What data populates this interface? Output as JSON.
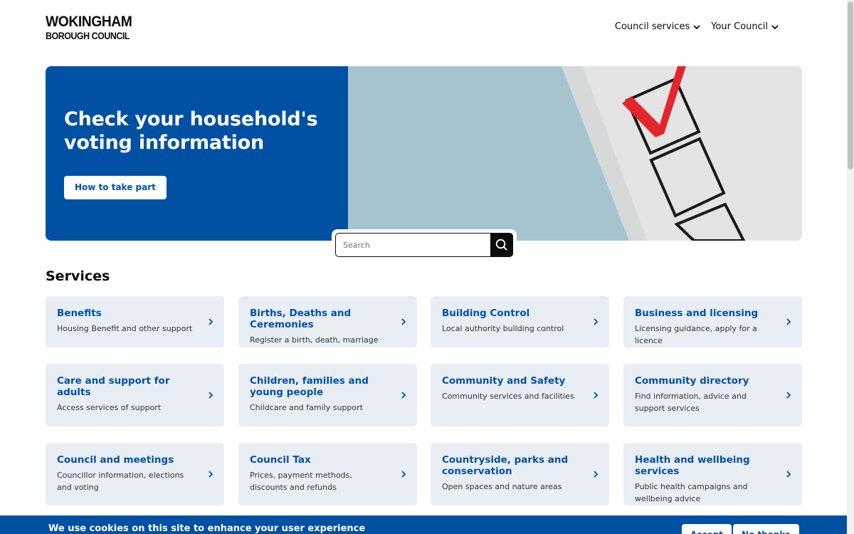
{
  "header": {
    "logo_line1": "WOKINGHAM",
    "logo_line2": "BOROUGH COUNCIL",
    "nav": [
      {
        "label": "Council services"
      },
      {
        "label": "Your Council"
      }
    ]
  },
  "hero": {
    "title": "Check your household's voting information",
    "button_label": "How to take part",
    "image_icon": "ballot-checkbox-icon"
  },
  "search": {
    "placeholder": "Search",
    "icon": "search-icon"
  },
  "services": {
    "heading": "Services",
    "cards": [
      {
        "title": "Benefits",
        "desc": "Housing Benefit and other support"
      },
      {
        "title": "Births, Deaths and Ceremonies",
        "desc": "Register a birth, death, marriage"
      },
      {
        "title": "Building Control",
        "desc": "Local authority building control"
      },
      {
        "title": "Business and licensing",
        "desc": "Licensing guidance, apply for a licence"
      },
      {
        "title": "Care and support for adults",
        "desc": "Access services of support"
      },
      {
        "title": "Children, families and young people",
        "desc": "Childcare and family support"
      },
      {
        "title": "Community and Safety",
        "desc": "Community services and facilities"
      },
      {
        "title": "Community directory",
        "desc": "Find information, advice and support services"
      },
      {
        "title": "Council and meetings",
        "desc": "Councillor information, elections and voting"
      },
      {
        "title": "Council Tax",
        "desc": "Prices, payment methods, discounts and refunds"
      },
      {
        "title": "Countryside, parks and conservation",
        "desc": "Open spaces and nature areas"
      },
      {
        "title": "Health and wellbeing services",
        "desc": "Public health campaigns and wellbeing advice"
      }
    ]
  },
  "cookie_banner": {
    "text": "We use cookies on this site to enhance your user experience",
    "accept_label": "Accept",
    "decline_label": "No thanks"
  },
  "colors": {
    "brand_blue": "#0050a4",
    "card_bg": "#e9eef4",
    "text_dark": "#0b0c0c"
  }
}
